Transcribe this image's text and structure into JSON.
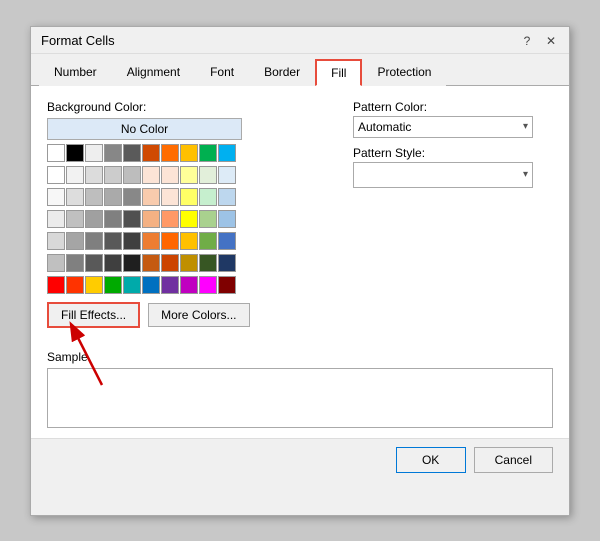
{
  "dialog": {
    "title": "Format Cells",
    "help_icon": "?",
    "close_icon": "✕"
  },
  "tabs": [
    {
      "label": "Number",
      "active": false
    },
    {
      "label": "Alignment",
      "active": false
    },
    {
      "label": "Font",
      "active": false
    },
    {
      "label": "Border",
      "active": false
    },
    {
      "label": "Fill",
      "active": true
    },
    {
      "label": "Protection",
      "active": false
    }
  ],
  "left": {
    "background_color_label": "Background Color:",
    "no_color_label": "No Color",
    "fill_effects_label": "Fill Effects...",
    "more_colors_label": "More Colors..."
  },
  "right": {
    "pattern_color_label": "Pattern Color:",
    "pattern_color_value": "Automatic",
    "pattern_style_label": "Pattern Style:",
    "pattern_style_value": ""
  },
  "sample": {
    "label": "Sample"
  },
  "footer": {
    "ok_label": "OK",
    "cancel_label": "Cancel"
  },
  "colors": {
    "row1": [
      "#FFFFFF",
      "#000000",
      "#EEEEEE",
      "#AAAAAA",
      "#7F7F7F",
      "#FF0000",
      "#FF6600",
      "#FFFF00",
      "#00AA00",
      "#00AAFF"
    ],
    "row2": [
      "#FFFFFF",
      "#F2F2F2",
      "#DCDCDC",
      "#C0C0C0",
      "#A0A0A0",
      "#FFCCCC",
      "#FFE4CC",
      "#FFFFCC",
      "#CCFFCC",
      "#CCFFFF"
    ],
    "row3": [
      "#F7F7F7",
      "#D8D8D8",
      "#BFBFBF",
      "#A6A6A6",
      "#8B8B8B",
      "#FF9999",
      "#FFCC99",
      "#FFFF99",
      "#99FF99",
      "#99FFFF"
    ],
    "row4": [
      "#EBEBEB",
      "#BFBFBF",
      "#A0A0A0",
      "#808080",
      "#606060",
      "#FF6666",
      "#FF9966",
      "#FFFF66",
      "#66FF66",
      "#66FFFF"
    ],
    "row5": [
      "#D4D4D4",
      "#A0A0A0",
      "#7F7F7F",
      "#606060",
      "#404040",
      "#FF3333",
      "#FF6633",
      "#FFFF33",
      "#33FF33",
      "#33FFFF"
    ],
    "row6": [
      "#BEBEBE",
      "#888888",
      "#666666",
      "#404040",
      "#202020",
      "#CC0000",
      "#CC5500",
      "#CCCC00",
      "#006600",
      "#0055AA"
    ],
    "row7": [
      "#FF0000",
      "#FF2200",
      "#FFCC00",
      "#00BB00",
      "#00CCCC",
      "#0000FF",
      "#6600CC",
      "#9900CC",
      "#CC00CC",
      "#880000"
    ],
    "accent_colors": [
      "#8B0000",
      "#C00000",
      "#FF0000",
      "#FF6600",
      "#FFC000",
      "#FFFF00",
      "#00FF00",
      "#00FFFF",
      "#0070C0",
      "#7030A0"
    ]
  }
}
